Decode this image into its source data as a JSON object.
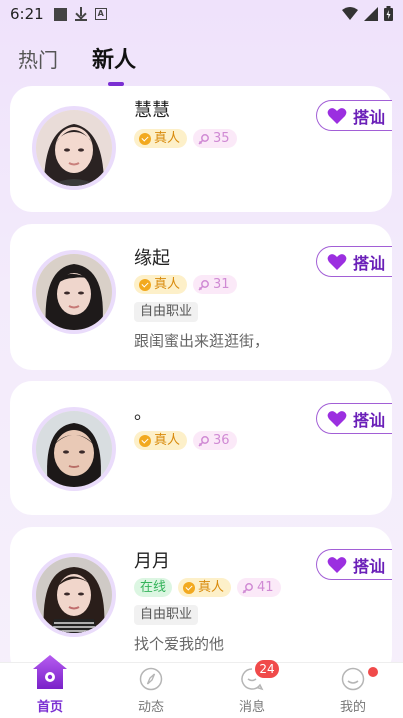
{
  "status_bar": {
    "time": "6:21",
    "a_icon_letter": "A"
  },
  "tabs": {
    "hot": "热门",
    "new": "新人"
  },
  "chat_button_label": "搭讪",
  "users": [
    {
      "name": "慧慧",
      "real_label": "真人",
      "age": "35",
      "online": "",
      "occupation": "",
      "bio": ""
    },
    {
      "name": "缘起",
      "real_label": "真人",
      "age": "31",
      "online": "",
      "occupation": "自由职业",
      "bio": "跟闺蜜出来逛逛街，"
    },
    {
      "name": "。",
      "real_label": "真人",
      "age": "36",
      "online": "",
      "occupation": "",
      "bio": ""
    },
    {
      "name": "月月",
      "real_label": "真人",
      "age": "41",
      "online": "在线",
      "occupation": "自由职业",
      "bio": "找个爱我的他"
    }
  ],
  "nav": {
    "home": "首页",
    "moments": "动态",
    "messages": "消息",
    "messages_badge": "24",
    "me": "我的"
  },
  "colors": {
    "accent": "#7b2fd2",
    "real_badge": "#f2a91f",
    "online": "#34b35a",
    "badge_red": "#f04a4a"
  }
}
